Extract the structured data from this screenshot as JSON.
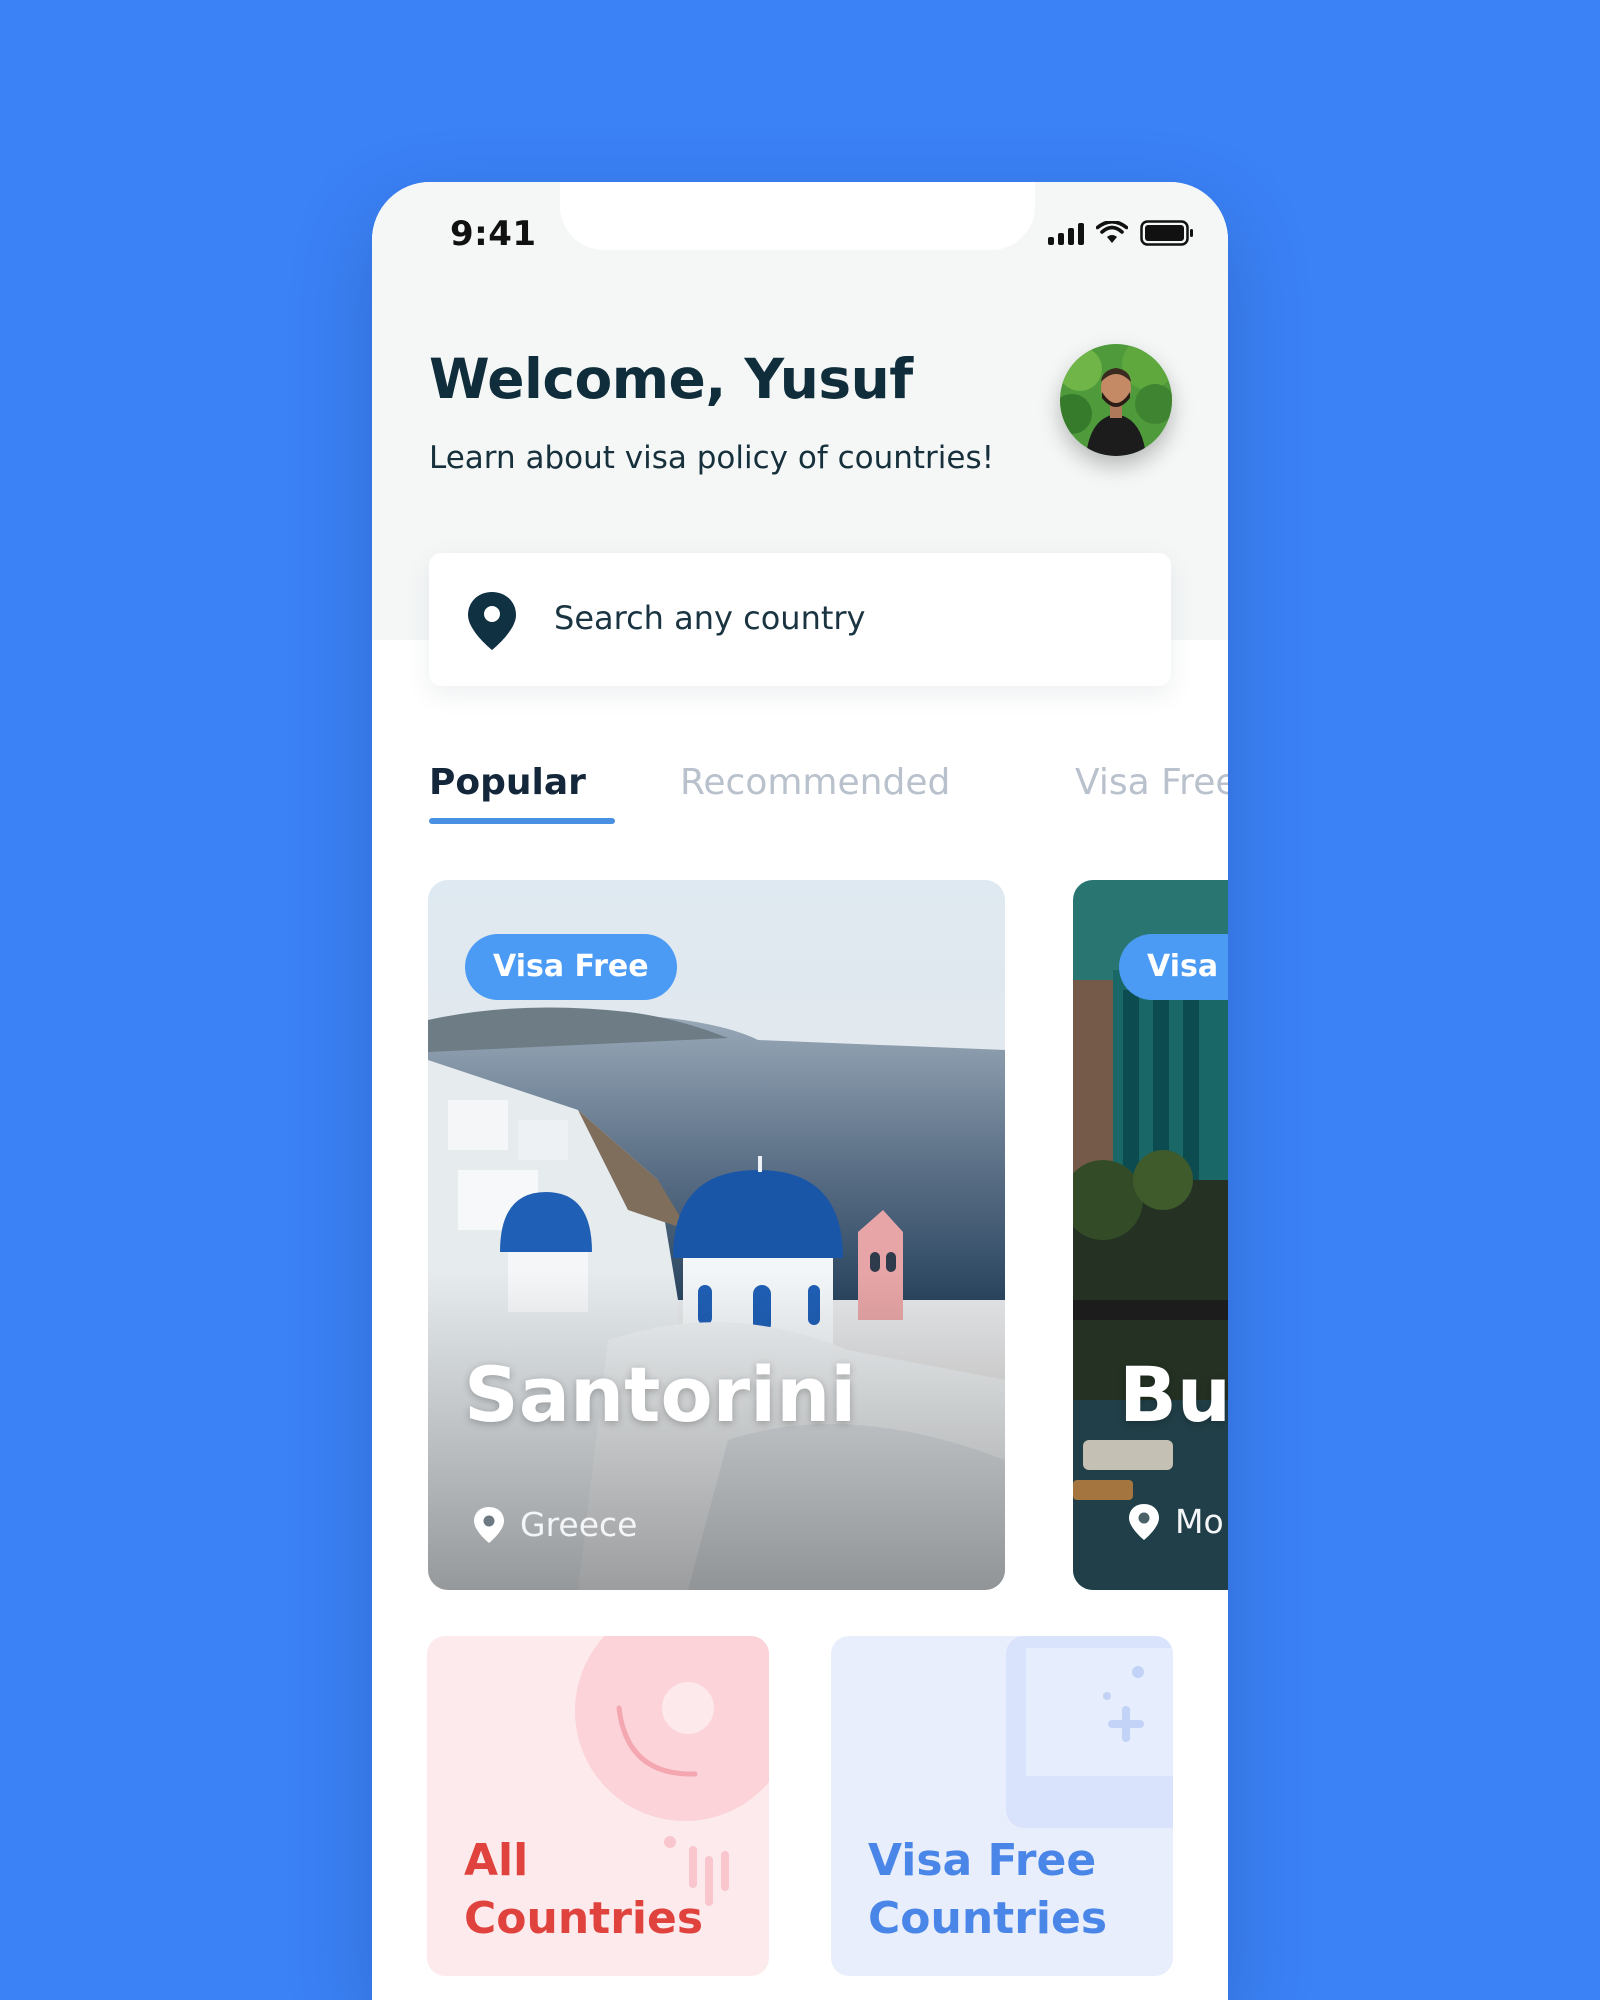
{
  "status_bar": {
    "time": "9:41"
  },
  "header": {
    "title": "Welcome, Yusuf",
    "subtitle": "Learn about visa policy of countries!"
  },
  "search": {
    "placeholder": "Search any country",
    "icon": "location-pin-icon"
  },
  "tabs": [
    {
      "label": "Popular",
      "active": true
    },
    {
      "label": "Recommended",
      "active": false
    },
    {
      "label": "Visa Free",
      "active": false
    }
  ],
  "cards": [
    {
      "badge": "Visa Free",
      "title": "Santorini",
      "location": "Greece"
    },
    {
      "badge": "Visa F",
      "title": "Bu",
      "location": "Mo"
    }
  ],
  "tiles": [
    {
      "line1": "All",
      "line2": "Countries",
      "color": "#e0433d"
    },
    {
      "line1": "Visa Free",
      "line2": "Countries",
      "color": "#4a86e8"
    }
  ],
  "colors": {
    "background": "#3b82f6",
    "accent": "#4a90e2",
    "badge": "#4b9bf5",
    "title_text": "#0f2d3a"
  }
}
